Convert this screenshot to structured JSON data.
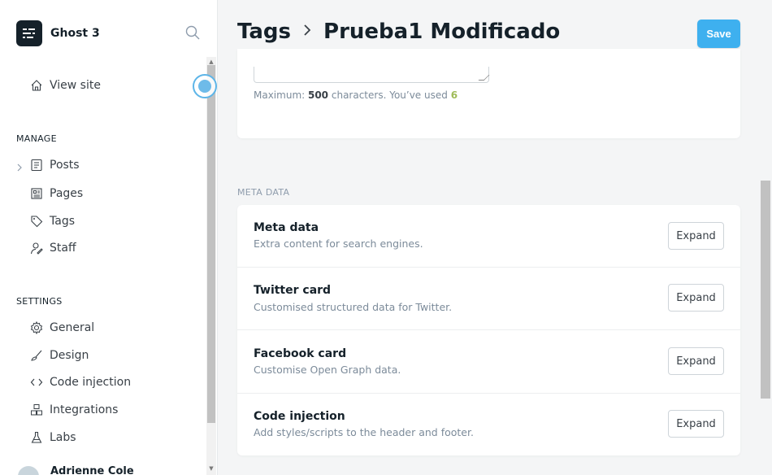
{
  "brand": {
    "name": "Ghost 3"
  },
  "sidebar": {
    "view_site": "View site",
    "manage_title": "MANAGE",
    "manage_items": [
      "Posts",
      "Pages",
      "Tags",
      "Staff"
    ],
    "settings_title": "SETTINGS",
    "settings_items": [
      "General",
      "Design",
      "Code injection",
      "Integrations",
      "Labs"
    ],
    "user_name": "Adrienne Cole"
  },
  "header": {
    "section": "Tags",
    "title": "Prueba1 Modificado",
    "save_label": "Save"
  },
  "description": {
    "counter_prefix": "Maximum: ",
    "max": "500",
    "counter_mid": " characters. You’ve used ",
    "used": "6"
  },
  "meta": {
    "section_label": "META DATA",
    "rows": [
      {
        "title": "Meta data",
        "desc": "Extra content for search engines.",
        "button": "Expand"
      },
      {
        "title": "Twitter card",
        "desc": "Customised structured data for Twitter.",
        "button": "Expand"
      },
      {
        "title": "Facebook card",
        "desc": "Customise Open Graph data.",
        "button": "Expand"
      },
      {
        "title": "Code injection",
        "desc": "Add styles/scripts to the header and footer.",
        "button": "Expand"
      }
    ]
  },
  "colors": {
    "accent": "#3eb0ef",
    "count_used": "#9fbb58"
  }
}
